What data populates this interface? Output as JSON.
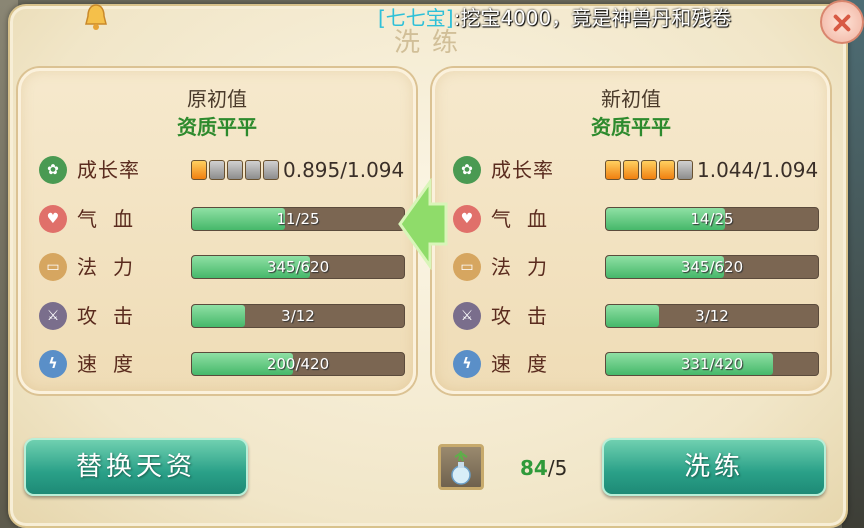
{
  "ticker": {
    "tag": "[七七宝]",
    "message": ":挖宝4000，竟是神兽丹和残卷"
  },
  "panel_title": "洗练",
  "left_card": {
    "title": "原初值",
    "subtitle": "资质平平",
    "growth": {
      "label": "成长率",
      "pips_on": 1,
      "pips_total": 5,
      "value": "0.895/1.094"
    },
    "stats": [
      {
        "label": "气血",
        "text": "11/25",
        "fraction": 0.44
      },
      {
        "label": "法力",
        "text": "345/620",
        "fraction": 0.556
      },
      {
        "label": "攻击",
        "text": "3/12",
        "fraction": 0.25
      },
      {
        "label": "速度",
        "text": "200/420",
        "fraction": 0.476
      }
    ]
  },
  "right_card": {
    "title": "新初值",
    "subtitle": "资质平平",
    "growth": {
      "label": "成长率",
      "pips_on": 4,
      "pips_total": 5,
      "value": "1.044/1.094"
    },
    "stats": [
      {
        "label": "气血",
        "text": "14/25",
        "fraction": 0.56
      },
      {
        "label": "法力",
        "text": "345/620",
        "fraction": 0.556
      },
      {
        "label": "攻击",
        "text": "3/12",
        "fraction": 0.25
      },
      {
        "label": "速度",
        "text": "331/420",
        "fraction": 0.788
      }
    ]
  },
  "buttons": {
    "replace_label": "替换天资",
    "refine_label": "洗练"
  },
  "material": {
    "have": "84",
    "need": "/5"
  },
  "icons": {
    "growth": "sprout-icon",
    "hp": "heart-icon",
    "mp": "scroll-icon",
    "attack": "sword-icon",
    "speed": "lightning-icon"
  },
  "colors": {
    "accent_green": "#2d8a2d",
    "button_teal": "#2aa088",
    "bar_fill": "#46b86a"
  }
}
